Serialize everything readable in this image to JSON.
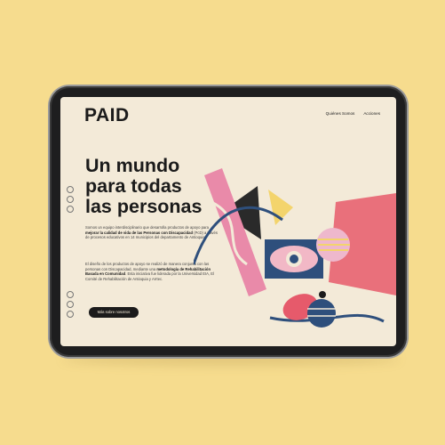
{
  "app": {
    "logo": "PAID"
  },
  "nav": {
    "items": [
      {
        "label": "Quiénes Somos"
      },
      {
        "label": "Acciones"
      }
    ]
  },
  "hero": {
    "title": "Un mundo\npara todas\nlas personas"
  },
  "intro": {
    "p1_before": "Somos un equipo interdisciplinario que desarrolla productos de apoyo para ",
    "p1_bold": "mejorar la calidad de vida de las Personas con Discapacidad",
    "p1_after": " (PcD) a través de procesos educativos en 14 municipios del departamento de Antioquia.",
    "p2_before": "El diseño de los productos de apoyo se realizó de manera conjunta con las personas con Discapacidad, mediante una ",
    "p2_bold": "metodología de Rehabilitación Basada en Comunidad",
    "p2_after": ". Esta iniciativa fue liderada por la Universidad EIA, El Comité de Rehabilitación de Antioquia y Arrtec."
  },
  "cta": {
    "label": "Más sobre nosotros"
  },
  "colors": {
    "background": "#f6dc8e",
    "screen": "#f3ead8",
    "text": "#1b1b1b",
    "pink": "#e98aa9",
    "blue": "#2e4f7c",
    "coral": "#e65a6b",
    "yellow": "#f3d46c"
  }
}
